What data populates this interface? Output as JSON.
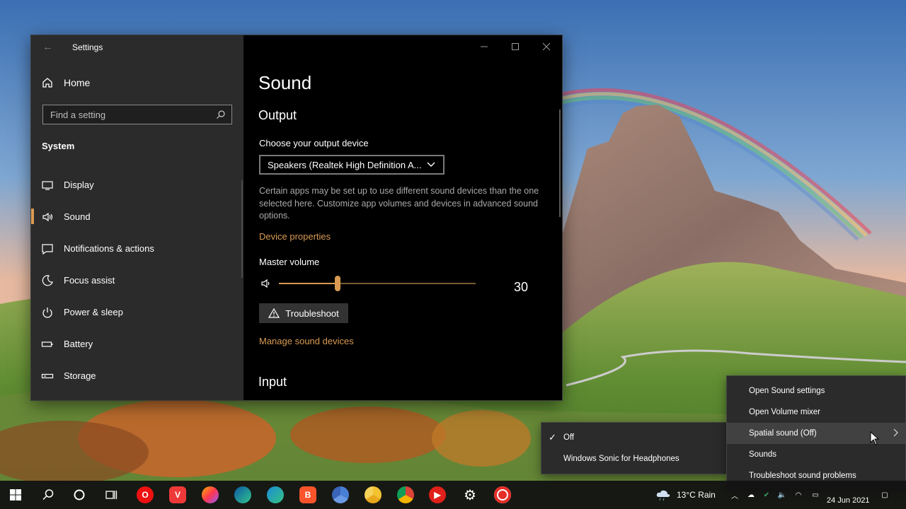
{
  "window": {
    "title": "Settings",
    "back_glyph": "←"
  },
  "sidebar": {
    "home_label": "Home",
    "search_placeholder": "Find a setting",
    "section_title": "System",
    "items": [
      {
        "label": "Display",
        "icon": "display-icon"
      },
      {
        "label": "Sound",
        "icon": "speaker-icon",
        "active": true
      },
      {
        "label": "Notifications & actions",
        "icon": "notification-icon"
      },
      {
        "label": "Focus assist",
        "icon": "moon-icon"
      },
      {
        "label": "Power & sleep",
        "icon": "power-icon"
      },
      {
        "label": "Battery",
        "icon": "battery-icon"
      },
      {
        "label": "Storage",
        "icon": "storage-icon"
      }
    ]
  },
  "main": {
    "page_title": "Sound",
    "output_heading": "Output",
    "choose_label": "Choose your output device",
    "device_selected": "Speakers (Realtek High Definition A...",
    "description": "Certain apps may be set up to use different sound devices than the one selected here. Customize app volumes and devices in advanced sound options.",
    "device_properties_link": "Device properties",
    "master_volume_label": "Master volume",
    "volume_value": "30",
    "volume_level": 0.3,
    "troubleshoot_label": "Troubleshoot",
    "manage_link": "Manage sound devices",
    "input_heading": "Input",
    "accent_color": "#d89a52"
  },
  "context_menu": {
    "items": [
      {
        "label": "Open Sound settings"
      },
      {
        "label": "Open Volume mixer"
      },
      {
        "label": "Spatial sound (Off)",
        "submenu": true,
        "hover": true
      },
      {
        "label": "Sounds"
      },
      {
        "label": "Troubleshoot sound problems"
      }
    ]
  },
  "submenu": {
    "items": [
      {
        "label": "Off",
        "checked": true
      },
      {
        "label": "Windows Sonic for Headphones"
      }
    ]
  },
  "taskbar": {
    "weather": "13°C  Rain",
    "date": "24 Jun 2021",
    "apps": [
      "opera-icon",
      "vivaldi-icon",
      "firefox-icon",
      "edge-can-icon",
      "edge-icon",
      "brave-icon",
      "chrome-blue-icon",
      "chrome-yellow-icon",
      "chrome-icon",
      "youtube-music-icon",
      "gear-icon",
      "record-icon"
    ]
  }
}
